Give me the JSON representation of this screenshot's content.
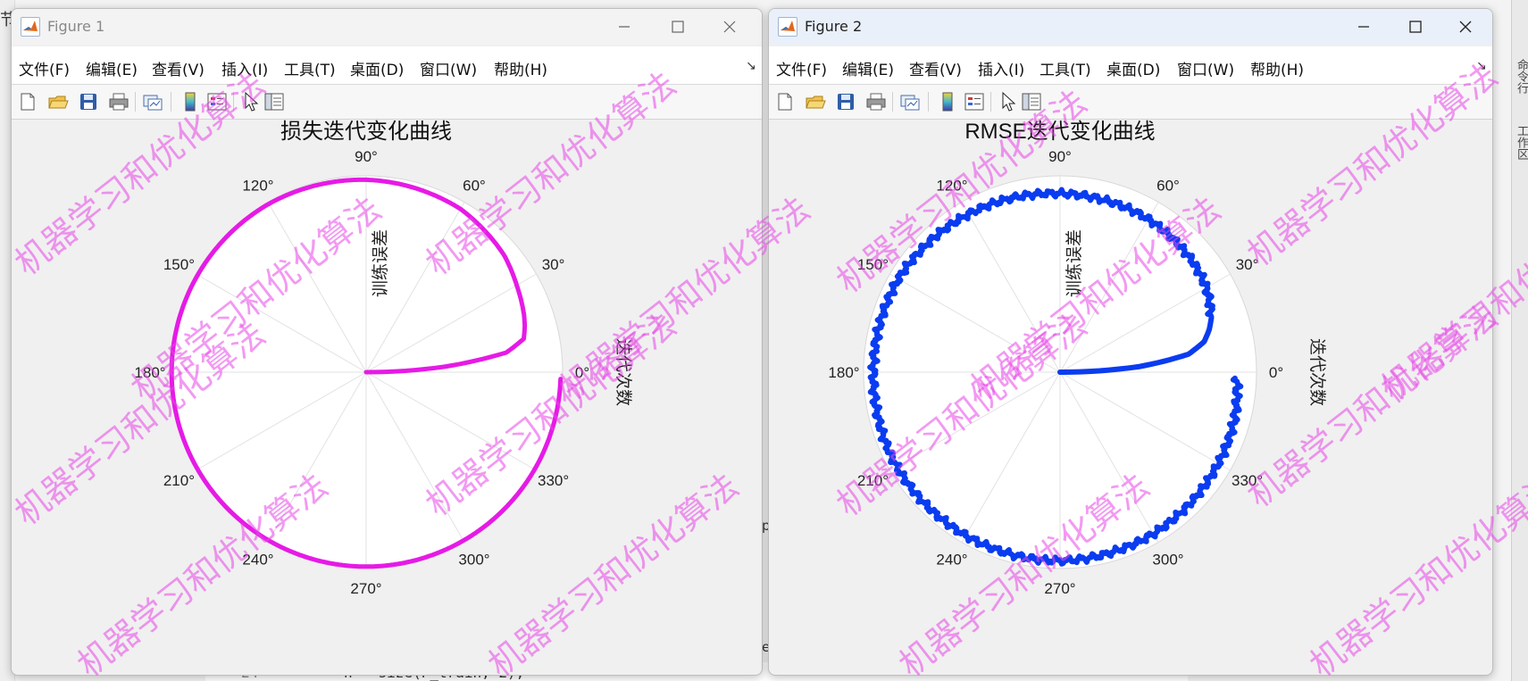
{
  "background": {
    "left_glyph": "节",
    "code_line_number": "24",
    "code_line_text": "n = size(P_train, 2);",
    "gap_text_1": "p",
    "gap_text_2": "e",
    "strip_text_1": "命令行",
    "strip_text_2": "工作区"
  },
  "windows": [
    {
      "title": "Figure 1",
      "menu": [
        "文件(F)",
        "编辑(E)",
        "查看(V)",
        "插入(I)",
        "工具(T)",
        "桌面(D)",
        "窗口(W)",
        "帮助(H)"
      ],
      "menu_arrow": "↘",
      "controls": {
        "minimize": "minimize-icon",
        "maximize": "maximize-icon",
        "close": "close-icon"
      },
      "toolbar_icons": [
        "new-figure-icon",
        "open-file-icon",
        "save-icon",
        "print-icon",
        "link-plot-icon",
        "insert-colorbar-icon",
        "insert-legend-icon",
        "edit-plot-icon",
        "open-property-inspector-icon"
      ]
    },
    {
      "title": "Figure 2",
      "menu": [
        "文件(F)",
        "编辑(E)",
        "查看(V)",
        "插入(I)",
        "工具(T)",
        "桌面(D)",
        "窗口(W)",
        "帮助(H)"
      ],
      "menu_arrow": "↘",
      "controls": {
        "minimize": "minimize-icon",
        "maximize": "maximize-icon",
        "close": "close-icon"
      },
      "toolbar_icons": [
        "new-figure-icon",
        "open-file-icon",
        "save-icon",
        "print-icon",
        "link-plot-icon",
        "insert-colorbar-icon",
        "insert-legend-icon",
        "edit-plot-icon",
        "open-property-inspector-icon"
      ]
    }
  ],
  "watermark": "机器学习和优化算法",
  "chart_data": [
    {
      "type": "polar",
      "title": "损失迭代变化曲线",
      "theta_label": "迭代次数",
      "r_label": "训练误差",
      "angle_ticks": [
        "0°",
        "30°",
        "60°",
        "90°",
        "120°",
        "150°",
        "180°",
        "210°",
        "240°",
        "270°",
        "300°",
        "330°"
      ],
      "series_color": "#e61ae6",
      "theta_range_deg": [
        0,
        360
      ],
      "r_range": [
        0,
        1
      ],
      "series": [
        {
          "theta_deg": [
            0,
            2,
            4,
            8,
            12,
            16,
            20,
            25,
            30,
            40,
            60,
            90,
            120,
            150,
            180,
            210,
            240,
            270,
            300,
            330,
            345,
            358
          ],
          "r": [
            0.0,
            0.2,
            0.4,
            0.72,
            0.82,
            0.84,
            0.855,
            0.87,
            0.885,
            0.92,
            0.96,
            0.98,
            0.99,
            0.99,
            0.99,
            0.99,
            0.99,
            0.99,
            0.99,
            0.99,
            0.99,
            0.99
          ]
        }
      ]
    },
    {
      "type": "polar",
      "title": "RMSE迭代变化曲线",
      "theta_label": "迭代次数",
      "r_label": "训练误差",
      "angle_ticks": [
        "0°",
        "30°",
        "60°",
        "90°",
        "120°",
        "150°",
        "180°",
        "210°",
        "240°",
        "270°",
        "300°",
        "330°"
      ],
      "series_color": "#0a3cf0",
      "theta_range_deg": [
        0,
        360
      ],
      "r_range": [
        0,
        1
      ],
      "series": [
        {
          "theta_deg": [
            0,
            2,
            4,
            8,
            12,
            16,
            20,
            25,
            30,
            40,
            60,
            90,
            120,
            150,
            180,
            210,
            240,
            270,
            300,
            330,
            345,
            358
          ],
          "r": [
            0.0,
            0.2,
            0.4,
            0.66,
            0.75,
            0.79,
            0.82,
            0.84,
            0.86,
            0.88,
            0.9,
            0.91,
            0.93,
            0.95,
            0.95,
            0.96,
            0.96,
            0.96,
            0.95,
            0.93,
            0.92,
            0.9
          ]
        }
      ]
    }
  ]
}
